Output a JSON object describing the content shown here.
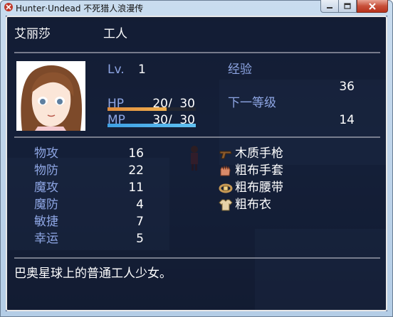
{
  "window": {
    "title": "Hunter·Undead 不死猎人浪漫传"
  },
  "actor": {
    "name": "艾丽莎",
    "class": "工人",
    "level_label": "Lv.",
    "level": "1",
    "hp_label": "HP",
    "hp": "20",
    "mhp": "30",
    "hp_rate": 0.667,
    "mp_label": "MP",
    "mp": "30",
    "mmp": "30",
    "mp_rate": 1.0,
    "hp_sep": "/",
    "mp_sep": "/",
    "exp_label": "经验",
    "exp": "36",
    "next_label": "下一等级",
    "next": "14",
    "profile": "巴奥星球上的普通工人少女。"
  },
  "params": [
    {
      "label": "物攻",
      "value": "16"
    },
    {
      "label": "物防",
      "value": "22"
    },
    {
      "label": "魔攻",
      "value": "11"
    },
    {
      "label": "魔防",
      "value": "4"
    },
    {
      "label": "敏捷",
      "value": "7"
    },
    {
      "label": "幸运",
      "value": "5"
    }
  ],
  "equips": [
    {
      "name": "木质手枪",
      "icon": "pistol-icon"
    },
    {
      "name": "粗布手套",
      "icon": "gloves-icon"
    },
    {
      "name": "粗布腰带",
      "icon": "belt-icon"
    },
    {
      "name": "粗布衣",
      "icon": "clothes-icon"
    }
  ],
  "colors": {
    "system_text": "#8ea6e4",
    "hp_gauge": "#e08c3c",
    "mp_gauge": "#3ea0e4"
  }
}
